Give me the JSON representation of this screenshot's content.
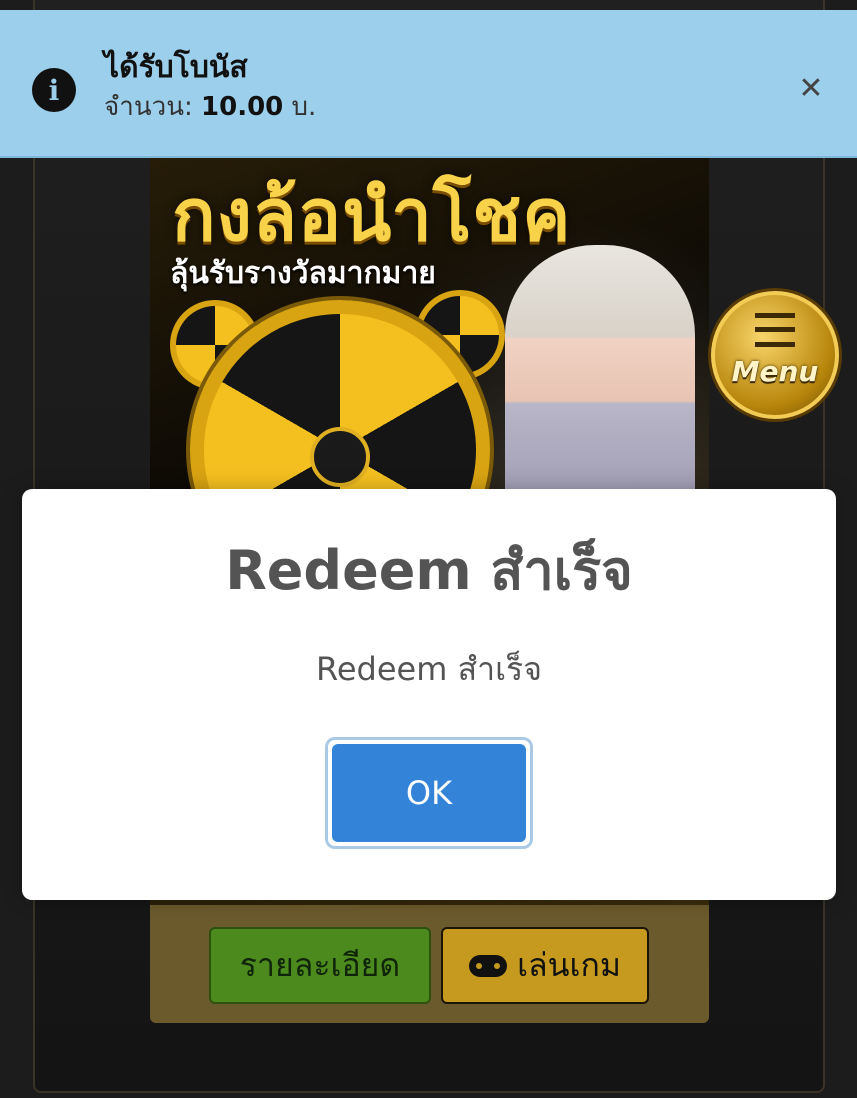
{
  "notification": {
    "title": "ได้รับโบนัส",
    "amount_label": "จำนวน:",
    "amount_value": "10.00",
    "currency": "บ.",
    "info_icon": "info-circle-icon",
    "close_icon": "close-icon"
  },
  "banner": {
    "title": "กงล้อนำโชค",
    "subtitle": "ลุ้นรับรางวัลมากมาย"
  },
  "menu_button": {
    "label": "Menu",
    "icon": "hamburger-icon"
  },
  "modal": {
    "title": "Redeem สำเร็จ",
    "text": "Redeem สำเร็จ",
    "ok_label": "OK"
  },
  "actions": {
    "detail_label": "รายละเอียด",
    "play_label": "เล่นเกม",
    "play_icon": "gamepad-icon"
  },
  "colors": {
    "toast_bg": "#9ccfeb",
    "ok_button": "#3384d8",
    "detail_button": "#4c8a1e",
    "play_button": "#c59a1e"
  }
}
